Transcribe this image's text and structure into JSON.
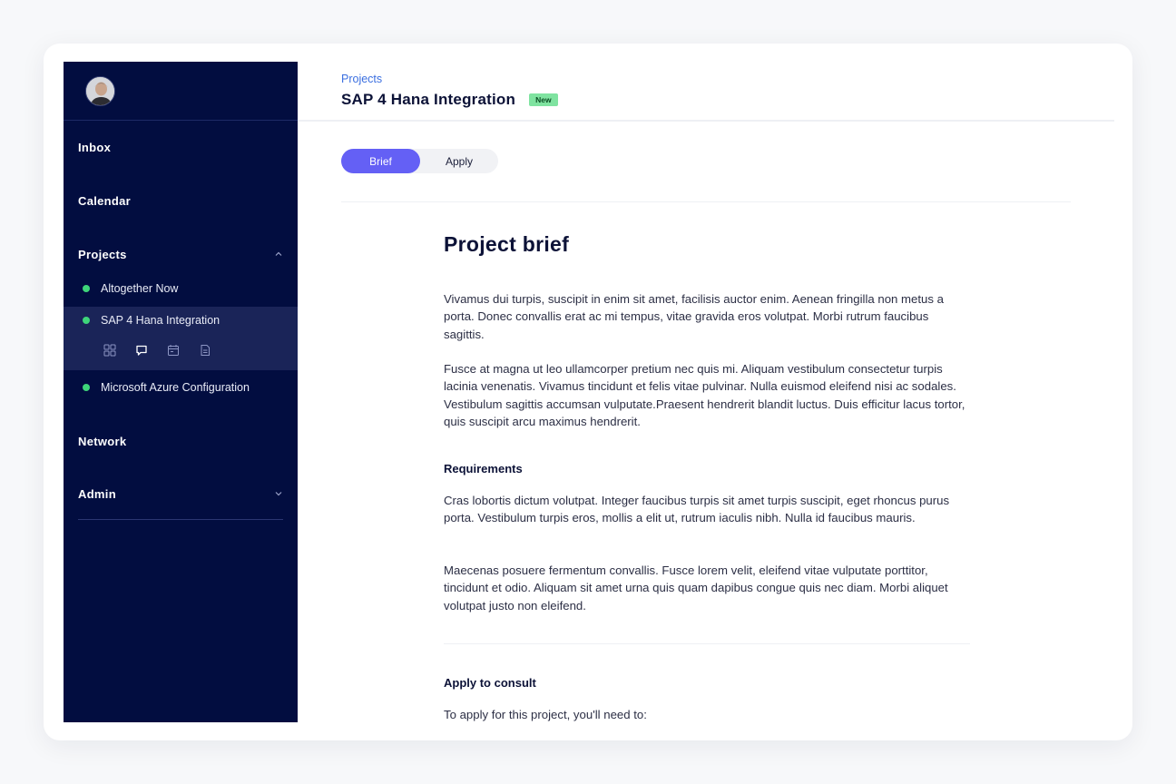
{
  "sidebar": {
    "nav": {
      "inbox": "Inbox",
      "calendar": "Calendar",
      "projects": "Projects",
      "network": "Network",
      "admin": "Admin"
    },
    "projects": [
      {
        "label": "Altogether Now",
        "status_color": "#3ed57a"
      },
      {
        "label": "SAP 4 Hana Integration",
        "status_color": "#3ed57a"
      },
      {
        "label": "Microsoft Azure Configuration",
        "status_color": "#3ed57a"
      }
    ],
    "sub_icons": [
      "grid-icon",
      "chat-icon",
      "calendar-icon",
      "document-icon"
    ]
  },
  "header": {
    "breadcrumb": "Projects",
    "title": "SAP 4 Hana Integration",
    "badge": "New"
  },
  "tabs": {
    "brief": "Brief",
    "apply": "Apply",
    "active": "Brief"
  },
  "brief": {
    "heading": "Project brief",
    "paragraphs": [
      "Vivamus dui turpis, suscipit in enim sit amet, facilisis auctor enim. Aenean fringilla non metus a porta. Donec convallis erat ac mi tempus, vitae gravida eros volutpat. Morbi rutrum faucibus sagittis.",
      "Fusce at magna ut leo ullamcorper pretium nec quis mi. Aliquam vestibulum consectetur turpis lacinia venenatis. Vivamus tincidunt et felis vitae pulvinar. Nulla euismod eleifend nisi ac sodales. Vestibulum sagittis accumsan vulputate.Praesent hendrerit blandit luctus. Duis efficitur lacus tortor, quis suscipit arcu maximus hendrerit."
    ],
    "requirements_heading": "Requirements",
    "requirements": [
      "Cras lobortis dictum volutpat. Integer faucibus turpis sit amet turpis suscipit, eget rhoncus purus porta. Vestibulum turpis eros, mollis a elit ut, rutrum iaculis nibh. Nulla id faucibus mauris.",
      "Maecenas posuere fermentum convallis. Fusce lorem velit, eleifend vitae vulputate porttitor, tincidunt et odio. Aliquam sit amet urna quis quam dapibus congue quis nec diam. Morbi aliquet volutpat justo non eleifend."
    ],
    "apply_heading": "Apply to consult",
    "apply_text": "To apply for this project, you'll need to:"
  },
  "colors": {
    "sidebar_bg": "#020d40",
    "accent": "#6460f5",
    "status_green": "#3ed57a",
    "link_blue": "#3b6fe0"
  }
}
